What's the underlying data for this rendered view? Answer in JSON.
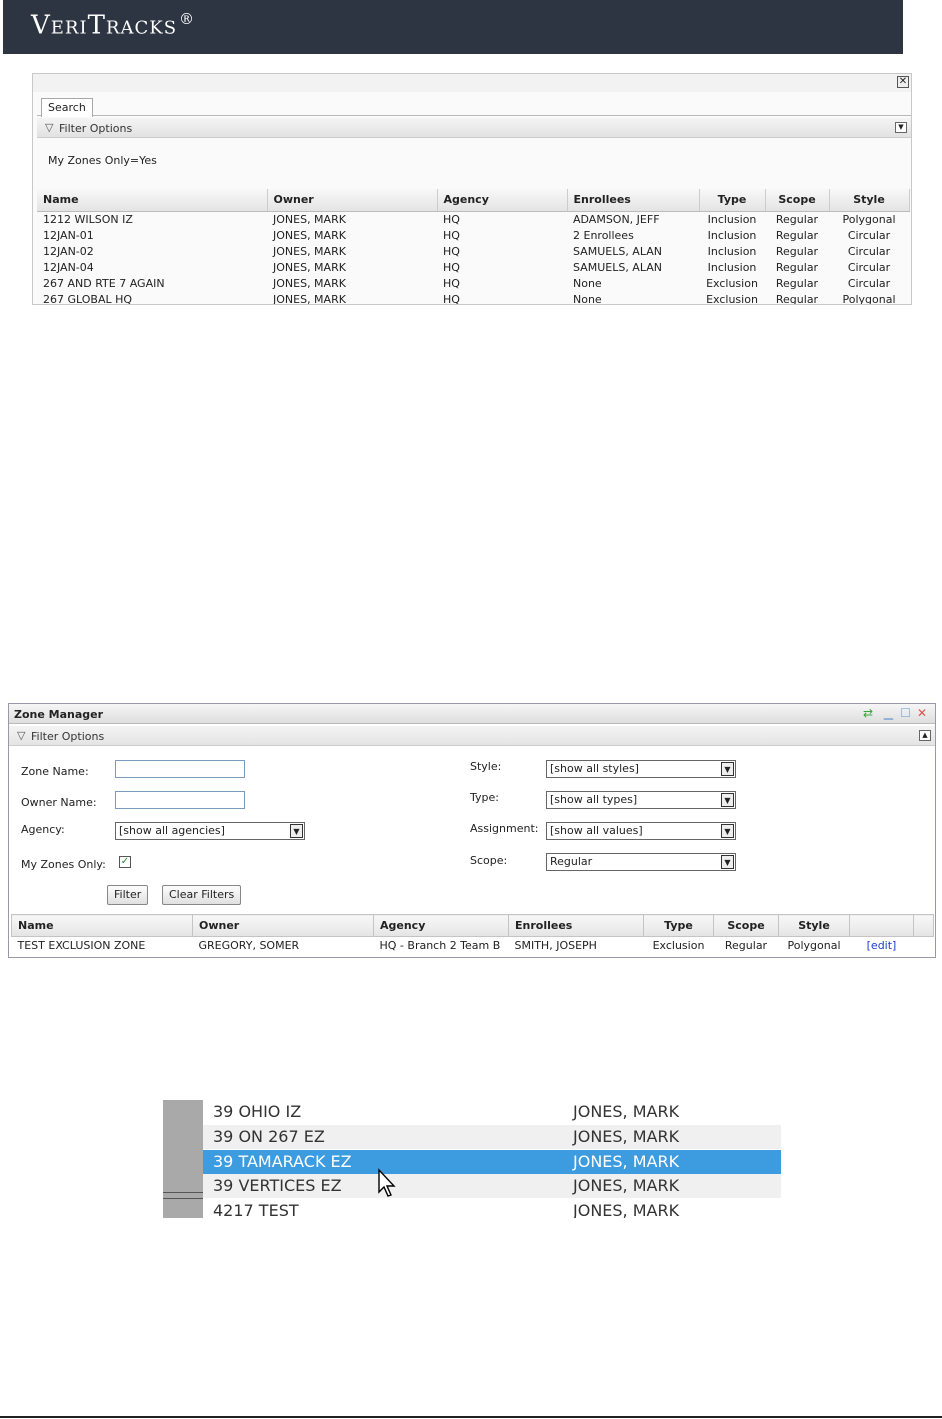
{
  "banner": {
    "logo_text": "VeriTracks",
    "reg_mark": "®"
  },
  "search_panel": {
    "close_glyph": "✕",
    "tab_label": "Search",
    "filter_label": "Filter Options",
    "filter_summary": "My Zones Only=Yes",
    "columns": [
      "Name",
      "Owner",
      "Agency",
      "Enrollees",
      "Type",
      "Scope",
      "Style"
    ],
    "rows": [
      [
        "1212 WILSON IZ",
        "JONES, MARK",
        "HQ",
        "ADAMSON, JEFF",
        "Inclusion",
        "Regular",
        "Polygonal"
      ],
      [
        "12JAN-01",
        "JONES, MARK",
        "HQ",
        "2 Enrollees",
        "Inclusion",
        "Regular",
        "Circular"
      ],
      [
        "12JAN-02",
        "JONES, MARK",
        "HQ",
        "SAMUELS, ALAN",
        "Inclusion",
        "Regular",
        "Circular"
      ],
      [
        "12JAN-04",
        "JONES, MARK",
        "HQ",
        "SAMUELS, ALAN",
        "Inclusion",
        "Regular",
        "Circular"
      ],
      [
        "267 AND RTE 7 AGAIN",
        "JONES, MARK",
        "HQ",
        "None",
        "Exclusion",
        "Regular",
        "Circular"
      ],
      [
        "267 GLOBAL HQ",
        "JONES, MARK",
        "HQ",
        "None",
        "Exclusion",
        "Regular",
        "Polygonal"
      ]
    ]
  },
  "zone_manager": {
    "title": "Zone Manager",
    "filter_label": "Filter Options",
    "fields": {
      "zone_name_label": "Zone Name:",
      "zone_name_value": "",
      "owner_name_label": "Owner Name:",
      "owner_name_value": "",
      "agency_label": "Agency:",
      "agency_value": "[show all agencies]",
      "my_zones_label": "My Zones Only:",
      "my_zones_checked": true,
      "style_label": "Style:",
      "style_value": "[show all styles]",
      "type_label": "Type:",
      "type_value": "[show all types]",
      "assignment_label": "Assignment:",
      "assignment_value": "[show all values]",
      "scope_label": "Scope:",
      "scope_value": "Regular"
    },
    "buttons": {
      "filter": "Filter",
      "clear": "Clear Filters"
    },
    "columns": [
      "Name",
      "Owner",
      "Agency",
      "Enrollees",
      "Type",
      "Scope",
      "Style"
    ],
    "rows": [
      {
        "name": "TEST EXCLUSION ZONE",
        "owner": "GREGORY, SOMER",
        "agency": "HQ - Branch 2 Team B",
        "enrollees": "SMITH, JOSEPH",
        "type": "Exclusion",
        "scope": "Regular",
        "style": "Polygonal",
        "action": "[edit]"
      }
    ]
  },
  "zoom_list": {
    "rows": [
      {
        "name": "39 OHIO IZ",
        "owner": "JONES, MARK",
        "state": "normal"
      },
      {
        "name": "39 ON 267 EZ",
        "owner": "JONES, MARK",
        "state": "alt"
      },
      {
        "name": "39 TAMARACK EZ",
        "owner": "JONES, MARK",
        "state": "selected"
      },
      {
        "name": "39 VERTICES EZ",
        "owner": "JONES, MARK",
        "state": "alt"
      },
      {
        "name": "4217 TEST",
        "owner": "JONES, MARK",
        "state": "normal"
      }
    ]
  },
  "colors": {
    "banner": "#2d3442",
    "selection": "#3d9be0",
    "link": "#1a3fcc",
    "check": "#2a8a2a",
    "close_red": "#d9534f",
    "refresh_green": "#3aa63a"
  }
}
